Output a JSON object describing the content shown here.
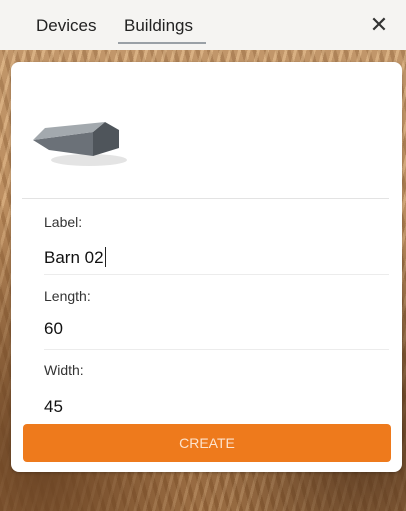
{
  "tabs": {
    "devices_label": "Devices",
    "buildings_label": "Buildings",
    "active": "Buildings"
  },
  "close_icon": "close-icon",
  "card": {
    "preview_icon": "building-icon",
    "fields": {
      "label": {
        "title": "Label:",
        "value": "Barn 02"
      },
      "length": {
        "title": "Length:",
        "value": "60"
      },
      "width": {
        "title": "Width:",
        "value": "45"
      }
    },
    "create_label": "CREATE"
  },
  "colors": {
    "accent": "#ee7a1c",
    "tab_underline": "#9aa0a6",
    "building_roof": "#8a9096",
    "building_wall": "#5b6167"
  }
}
